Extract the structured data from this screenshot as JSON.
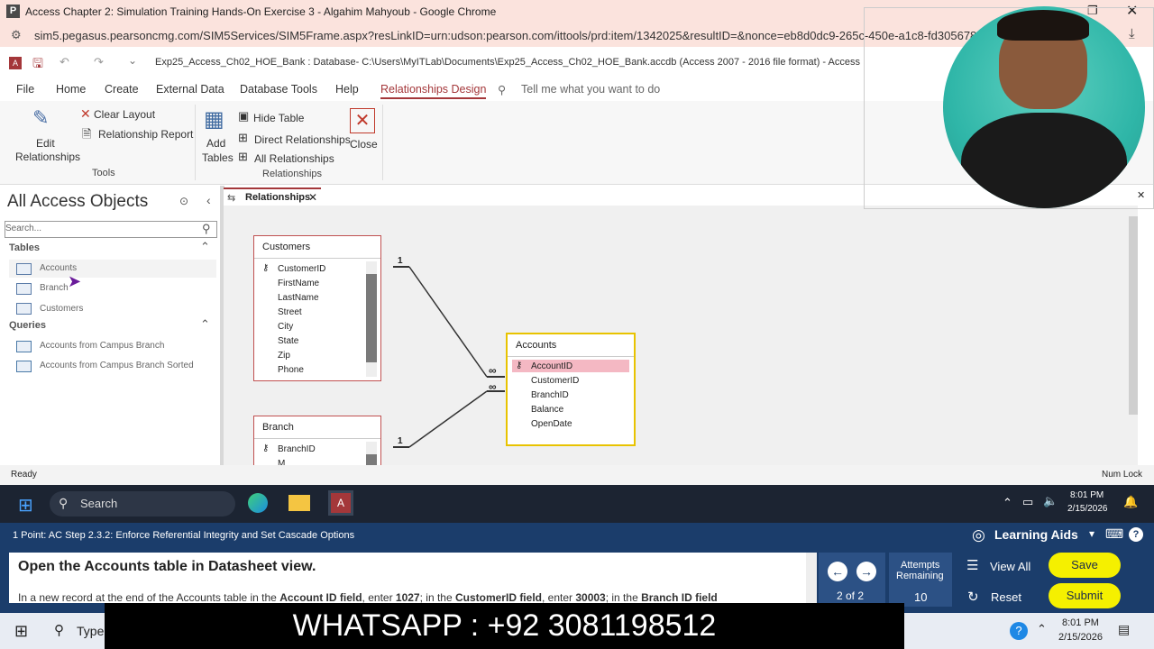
{
  "browser": {
    "title": "Access Chapter 2: Simulation Training Hands-On Exercise 3 - Algahim Mahyoub - Google Chrome",
    "url": "sim5.pegasus.pearsoncmg.com/SIM5Services/SIM5Frame.aspx?resLinkID=urn:udson:pearson.com/ittools/prd:item/1342025&resultID=&nonce=eb8d0dc9-265c-450e-a1c8-fd305678"
  },
  "access": {
    "window_title": "Exp25_Access_Ch02_HOE_Bank : Database- C:\\Users\\MyITLab\\Documents\\Exp25_Access_Ch02_HOE_Bank.accdb (Access 2007 - 2016 file format) - Access",
    "menu": [
      "File",
      "Home",
      "Create",
      "External Data",
      "Database Tools",
      "Help",
      "Relationships Design"
    ],
    "tell_me": "Tell me what you want to do",
    "ribbon": {
      "edit_relationships_1": "Edit",
      "edit_relationships_2": "Relationships",
      "clear_layout": "Clear Layout",
      "relationship_report": "Relationship Report",
      "tools_label": "Tools",
      "add_tables_1": "Add",
      "add_tables_2": "Tables",
      "hide_table": "Hide Table",
      "direct_relationships": "Direct Relationships",
      "all_relationships": "All Relationships",
      "relationships_label": "Relationships",
      "close": "Close"
    },
    "nav": {
      "title": "All Access Objects",
      "search_placeholder": "Search...",
      "tables_header": "Tables",
      "tables": [
        "Accounts",
        "Branch",
        "Customers"
      ],
      "queries_header": "Queries",
      "queries": [
        "Accounts from Campus Branch",
        "Accounts from Campus Branch Sorted"
      ]
    },
    "tab": "Relationships",
    "tables": {
      "customers": {
        "name": "Customers",
        "fields": [
          "CustomerID",
          "FirstName",
          "LastName",
          "Street",
          "City",
          "State",
          "Zip",
          "Phone"
        ]
      },
      "accounts": {
        "name": "Accounts",
        "fields": [
          "AccountID",
          "CustomerID",
          "BranchID",
          "Balance",
          "OpenDate"
        ]
      },
      "branch": {
        "name": "Branch",
        "fields": [
          "BranchID",
          "M"
        ]
      }
    },
    "rel_one": "1",
    "rel_many": "∞",
    "status_left": "Ready",
    "status_right": "Num Lock"
  },
  "taskbar": {
    "search": "Search",
    "time": "8:01 PM",
    "date": "2/15/2026"
  },
  "pearson": {
    "step": "1 Point: AC Step 2.3.2: Enforce Referential Integrity and Set Cascade Options",
    "learning_aids": "Learning Aids",
    "instruction_title": "Open the Accounts table in Datasheet view.",
    "instruction_text_1": "In a new record at the end of the Accounts table in the ",
    "instruction_bold_1": "Account ID field",
    "instruction_text_2": ", enter ",
    "instruction_bold_2": "1027",
    "instruction_text_3": "; in the ",
    "instruction_bold_3": "CustomerID field",
    "instruction_text_4": ", enter ",
    "instruction_bold_4": "30003",
    "instruction_text_5": "; in the ",
    "instruction_bold_5": "Branch ID field",
    "page": "2 of 2",
    "attempts_label_1": "Attempts",
    "attempts_label_2": "Remaining",
    "attempts": "10",
    "view_all": "View All",
    "reset": "Reset",
    "save": "Save",
    "submit": "Submit"
  },
  "bottom_taskbar": {
    "type": "Type",
    "time": "8:01 PM",
    "date": "2/15/2026"
  },
  "overlay": {
    "whatsapp": "WHATSAPP :  +92 3081198512"
  },
  "colors": {
    "accent_access": "#a4373a",
    "pearson_blue": "#1b3d6b",
    "button_yellow": "#f5f000"
  }
}
